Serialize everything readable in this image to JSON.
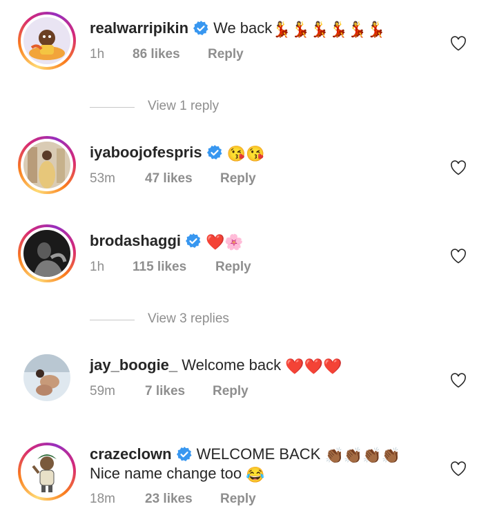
{
  "comments": [
    {
      "username": "realwarripikin",
      "verified": true,
      "text": "We back",
      "emoji": "💃💃💃💃💃💃",
      "time": "1h",
      "likes": "86 likes",
      "reply": "Reply",
      "avatar_icon": "cartoon-avatar"
    },
    {
      "username": "iyaboojofespris",
      "verified": true,
      "text": "",
      "emoji": "😘😘",
      "time": "53m",
      "likes": "47 likes",
      "reply": "Reply",
      "avatar_icon": "photo-avatar"
    },
    {
      "username": "brodashaggi",
      "verified": true,
      "text": "",
      "emoji": "❤️🌸",
      "time": "1h",
      "likes": "115 likes",
      "reply": "Reply",
      "avatar_icon": "photo-avatar"
    },
    {
      "username": "jay_boogie_",
      "verified": false,
      "text": "Welcome back",
      "emoji": "❤️❤️❤️",
      "time": "59m",
      "likes": "7 likes",
      "reply": "Reply",
      "avatar_icon": "photo-avatar"
    },
    {
      "username": "crazeclown",
      "verified": true,
      "text": "WELCOME BACK",
      "emoji": "👏🏾👏🏾👏🏾👏🏾",
      "text2": "Nice name change too",
      "emoji2": "😂",
      "time": "18m",
      "likes": "23 likes",
      "reply": "Reply",
      "avatar_icon": "cartoon-avatar"
    }
  ],
  "view_replies": [
    "View 1 reply",
    "View 3 replies"
  ],
  "colors": {
    "text": "#262626",
    "muted": "#8e8e8e",
    "verified": "#3897f0",
    "ring_start": "#feda75",
    "ring_end": "#962fbf"
  }
}
